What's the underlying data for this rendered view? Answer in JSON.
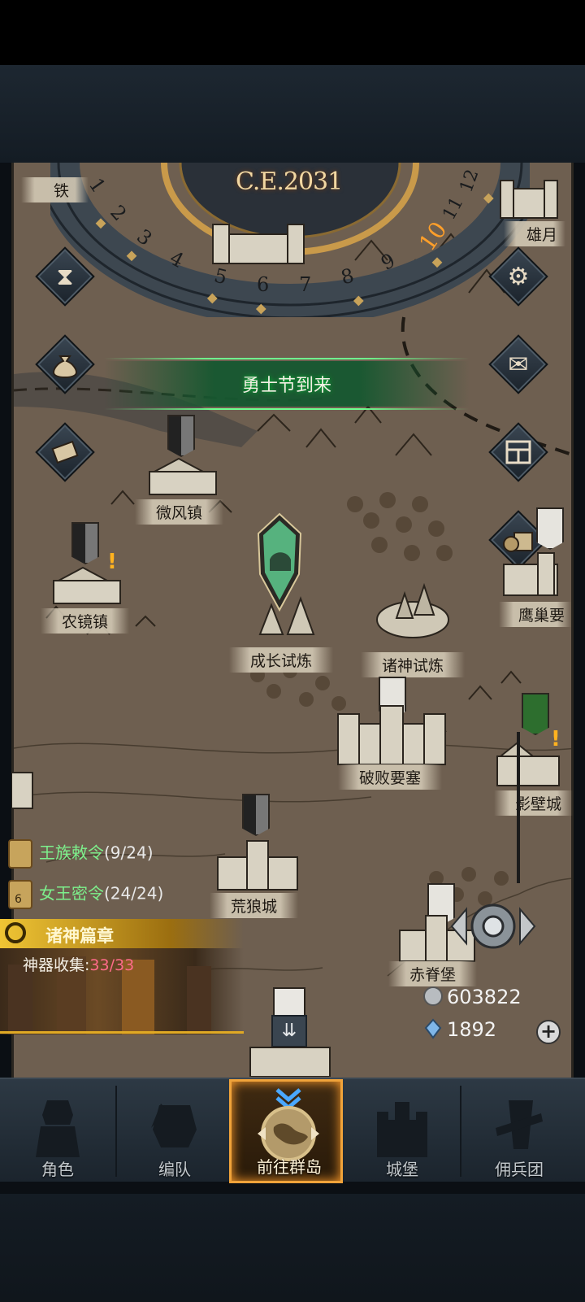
{
  "calendar": {
    "year": "C.E.2031",
    "months": [
      "1",
      "2",
      "3",
      "4",
      "5",
      "6",
      "7",
      "8",
      "9",
      "10",
      "11",
      "12"
    ],
    "current_month": "10"
  },
  "event_banner": {
    "text": "勇士节到来"
  },
  "left_buttons": [
    {
      "icon": "hourglass-icon"
    },
    {
      "icon": "money-bag-icon"
    },
    {
      "icon": "scroll-icon"
    }
  ],
  "right_buttons": [
    {
      "icon": "gear-icon"
    },
    {
      "icon": "mail-icon"
    },
    {
      "icon": "grid-menu-icon"
    },
    {
      "icon": "supply-crate-icon"
    }
  ],
  "locations": [
    {
      "name": "铁"
    },
    {
      "name": "雄月"
    },
    {
      "name": "微风镇"
    },
    {
      "name": "农镜镇"
    },
    {
      "name": "成长试炼"
    },
    {
      "name": "诸神试炼"
    },
    {
      "name": "鹰巢要"
    },
    {
      "name": "破败要塞"
    },
    {
      "name": "影壁城"
    },
    {
      "name": "荒狼城"
    },
    {
      "name": "赤脊堡"
    }
  ],
  "quests": [
    {
      "name": "王族敕令",
      "progress": "(9/24)"
    },
    {
      "name": "女王密令",
      "progress": "(24/24)",
      "badge": "6"
    }
  ],
  "chapter": {
    "title": "诸神篇章",
    "sub_label": "神器收集:",
    "sub_value": "33/33"
  },
  "resources": {
    "silver": "603822",
    "crystal": "1892"
  },
  "nav": [
    {
      "label": "角色"
    },
    {
      "label": "编队"
    },
    {
      "label": "前往群岛",
      "active": true
    },
    {
      "label": "城堡"
    },
    {
      "label": "佣兵团"
    }
  ],
  "colors": {
    "accent_orange": "#ff9f2a",
    "quest_green": "#7df08c",
    "artifact_pink": "#ff6b8a",
    "banner_green": "#16582f"
  }
}
